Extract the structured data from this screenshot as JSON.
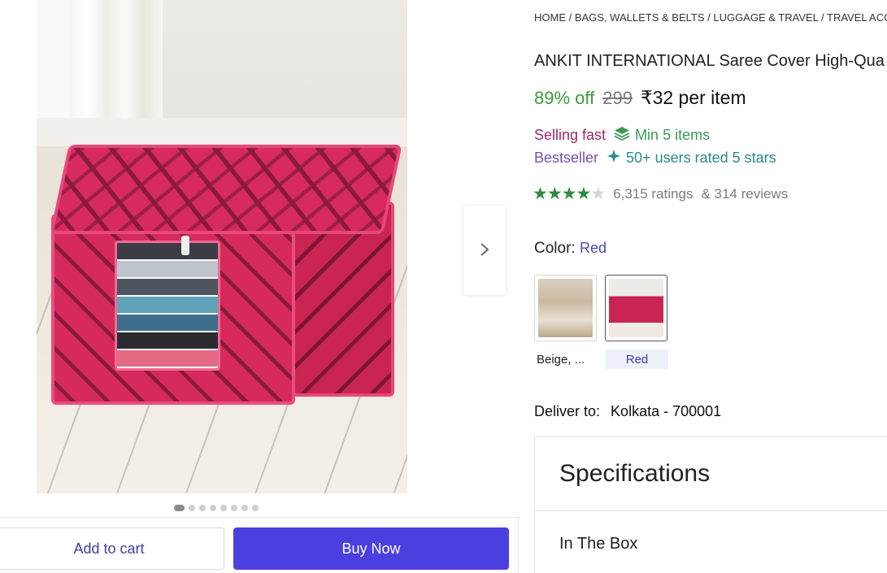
{
  "breadcrumb": "HOME / BAGS, WALLETS & BELTS / LUGGAGE & TRAVEL / TRAVEL ACCES",
  "product": {
    "title": "ANKIT INTERNATIONAL Saree Cover High-Qua",
    "discount": "89% off",
    "mrp": "299",
    "price": "₹32 per item"
  },
  "badges": {
    "selling_fast": "Selling fast",
    "min_items": "Min 5 items",
    "bestseller": "Bestseller",
    "users_rated": "50+ users rated 5 stars"
  },
  "rating": {
    "stars_filled": 4,
    "stars_total": 5,
    "ratings_text": "6,315 ratings",
    "reviews_text": "& 314 reviews"
  },
  "color": {
    "label": "Color:",
    "value": "Red",
    "swatches": [
      {
        "caption": "Beige, ...",
        "selected": false
      },
      {
        "caption": "Red",
        "selected": true
      }
    ]
  },
  "delivery": {
    "label": "Deliver to:",
    "location": "Kolkata - 700001"
  },
  "specifications": {
    "title": "Specifications",
    "first_item": "In The Box"
  },
  "gallery": {
    "dot_count": 8,
    "active_index": 0,
    "next_icon": "chevron-right-icon"
  },
  "actions": {
    "add_to_cart": "Add to cart",
    "buy_now": "Buy Now"
  },
  "colors": {
    "accent": "#4b3fe0",
    "discount_green": "#3b9b3a",
    "star_green": "#2e8b3e"
  }
}
